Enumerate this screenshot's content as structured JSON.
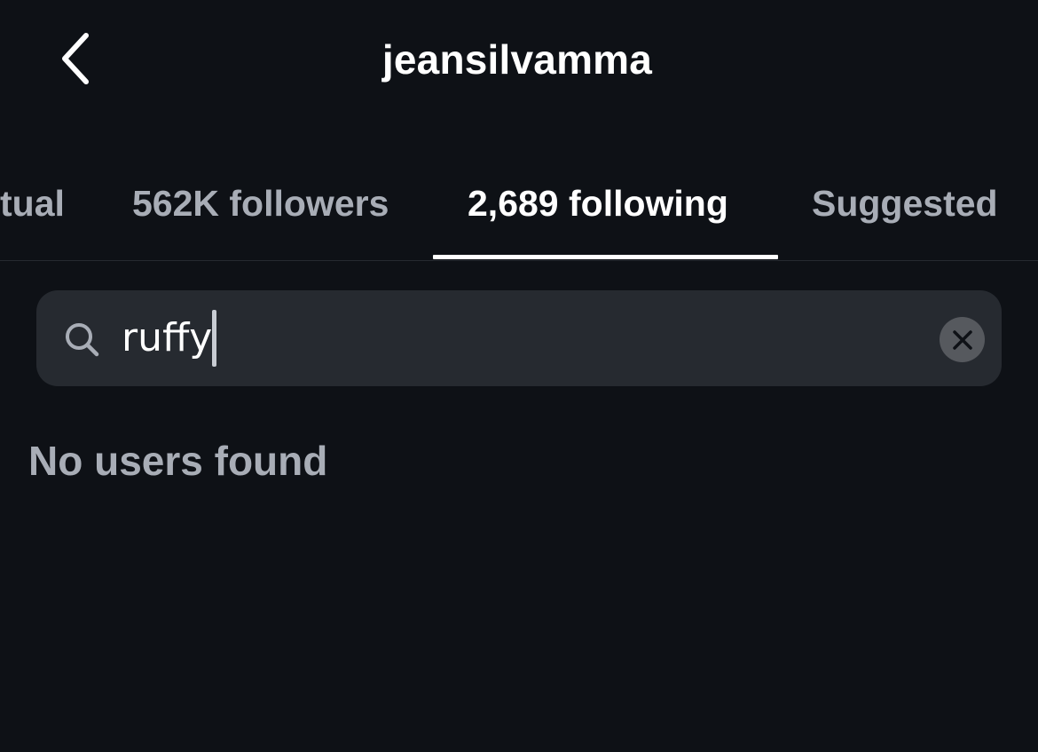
{
  "header": {
    "title": "jeansilvamma",
    "back_icon": "chevron-left-icon"
  },
  "tabs": [
    {
      "label": "Mutual",
      "visible_text": "tual",
      "active": false
    },
    {
      "label": "562K followers",
      "active": false
    },
    {
      "label": "2,689 following",
      "active": true
    },
    {
      "label": "Suggested",
      "active": false
    }
  ],
  "search": {
    "value": "ruffy",
    "icon": "search-icon",
    "clear_icon": "close-icon"
  },
  "results": {
    "empty_message": "No users found"
  },
  "colors": {
    "background": "#0e1116",
    "search_field": "#262a30",
    "secondary_text": "#a8adb6",
    "active_text": "#ffffff"
  }
}
